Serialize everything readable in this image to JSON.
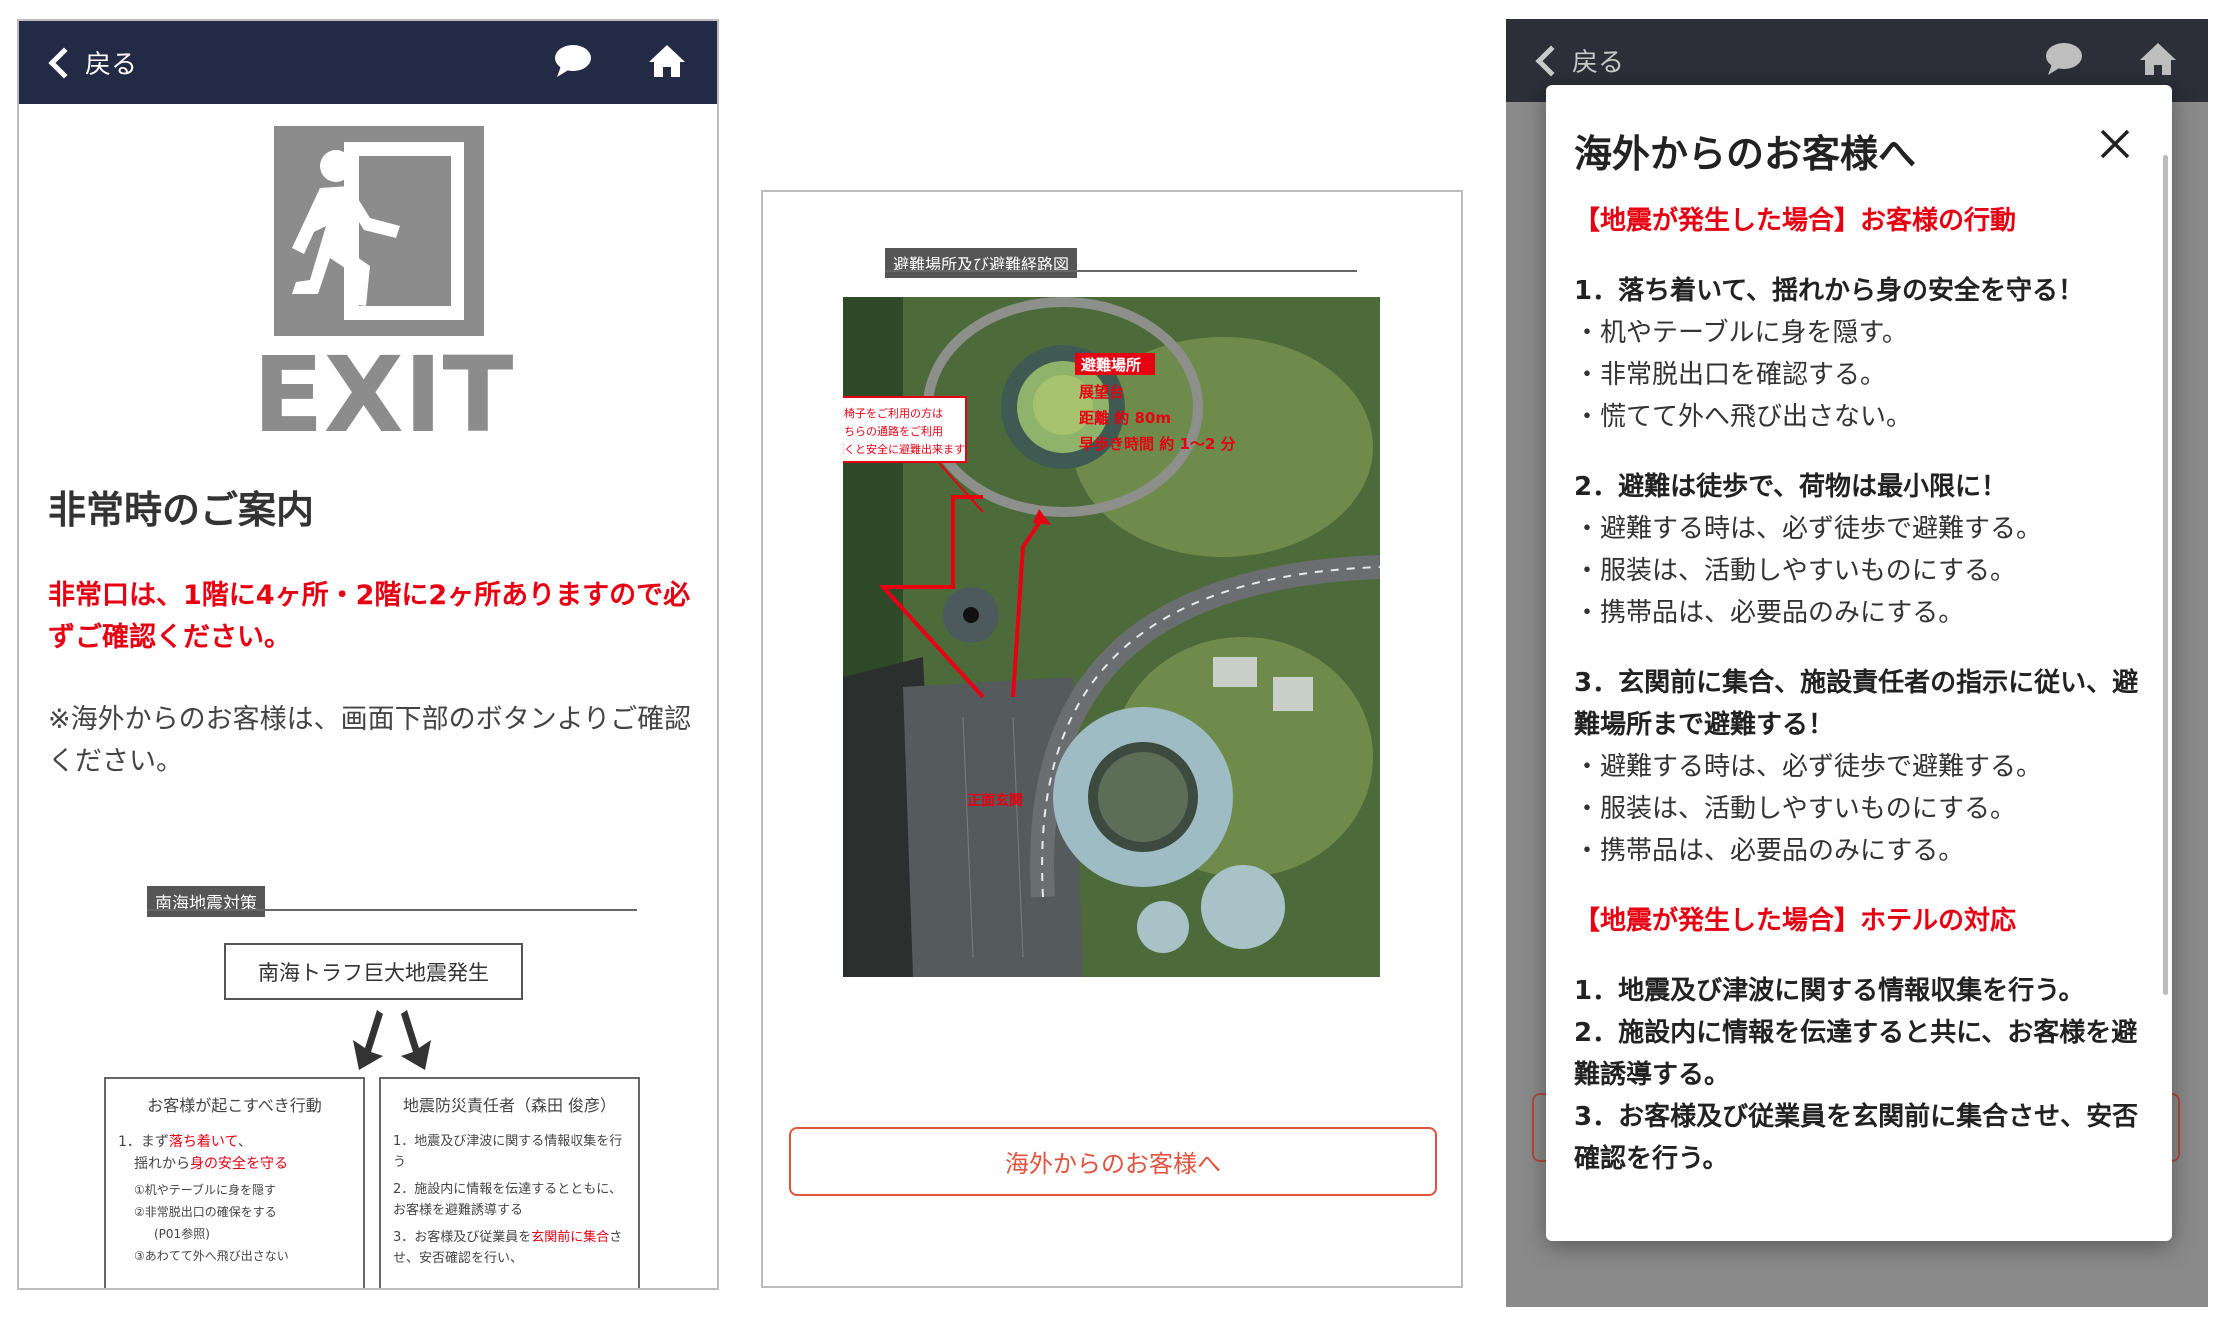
{
  "nav": {
    "back_label": "戻る",
    "chat_icon": "chat-bubble-icon",
    "home_icon": "home-icon"
  },
  "panel1": {
    "exit_text": "EXIT",
    "title": "非常時のご案内",
    "red_notice": "非常口は、1階に4ヶ所・2階に2ヶ所ありますので必ずご確認ください。",
    "foreign_note": "※海外からのお客様は、画面下部のボタンよりご確認ください。",
    "doc_tag": "南海地震対策",
    "doc_box": "南海トラフ巨大地震発生",
    "card_left": {
      "header": "お客様が起こすべき行動",
      "line1a": "1．まず",
      "line1b": "落ち着いて",
      "line1c": "、",
      "line1d": "揺れから",
      "line1e": "身の安全を守る",
      "sub1": "①机やテーブルに身を隠す",
      "sub2": "②非常脱出口の確保をする",
      "sub2b": "(P01参照)",
      "sub3": "③あわてて外へ飛び出さない"
    },
    "card_right": {
      "header": "地震防災責任者（森田 俊彦）",
      "l1": "1．地震及び津波に関する情報収集を行う",
      "l2": "2．施設内に情報を伝達するとともに、お客様を避難誘導する",
      "l3a": "3．お客様及び従業員を",
      "l3b": "玄関前に集合",
      "l3c": "させ、安否確認を行い、"
    }
  },
  "panel2": {
    "doc_tag": "避難場所及び避難経路図",
    "map": {
      "label_place": "避難場所",
      "label_tower": "展望台",
      "label_distance": "距離 約 80m",
      "label_time": "早歩き時間 約 1～2 分",
      "label_entrance": "正面玄関",
      "wheelchair_1": "車椅子をご利用の方は",
      "wheelchair_2": "こちらの通路をご利用",
      "wheelchair_3": "頂くと安全に避難出来ます"
    },
    "foreign_button": "海外からのお客様へ"
  },
  "panel3": {
    "modal_title": "海外からのお客様へ",
    "sec1": "【地震が発生した場合】お客様の行動",
    "item1": "1．落ち着いて、揺れから身の安全を守る！",
    "item1_subs": [
      "・机やテーブルに身を隠す。",
      "・非常脱出口を確認する。",
      "・慌てて外へ飛び出さない。"
    ],
    "item2": "2．避難は徒歩で、荷物は最小限に！",
    "item2_subs": [
      "・避難する時は、必ず徒歩で避難する。",
      "・服装は、活動しやすいものにする。",
      "・携帯品は、必要品のみにする。"
    ],
    "item3": "3．玄関前に集合、施設責任者の指示に従い、避難場所まで避難する！",
    "item3_subs": [
      "・避難する時は、必ず徒歩で避難する。",
      "・服装は、活動しやすいものにする。",
      "・携帯品は、必要品のみにする。"
    ],
    "sec2": "【地震が発生した場合】ホテルの対応",
    "hotel_items": [
      "1．地震及び津波に関する情報収集を行う。",
      "2．施設内に情報を伝達すると共に、お客様を避難誘導する。",
      "3．お客様及び従業員を玄関前に集合させ、安否確認を行う。"
    ]
  },
  "colors": {
    "navbar": "#232a45",
    "accent_red": "#e60012",
    "button_border": "#e0533e",
    "exit_gray": "#8c8c8c"
  }
}
